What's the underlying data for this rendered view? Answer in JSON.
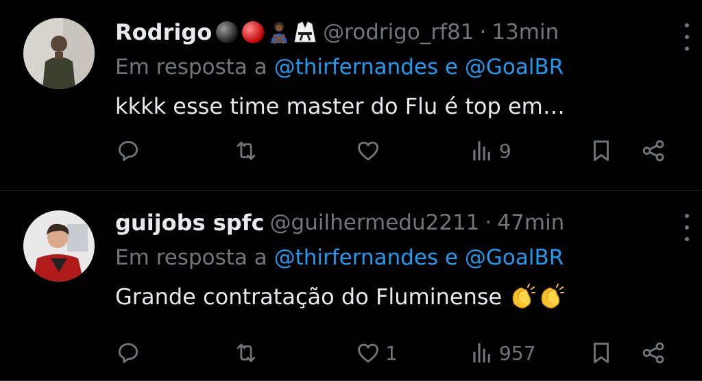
{
  "colors": {
    "background": "#000000",
    "text": "#e7e9ea",
    "muted": "#71767b",
    "link": "#1d9bf0",
    "divider": "#2f3336"
  },
  "tweets": [
    {
      "author": {
        "name": "Rodrigo",
        "handle": "@rodrigo_rf81",
        "badges": [
          "black-ball-emoji",
          "red-ball-emoji",
          "person-gesturing-no-emoji",
          "martial-arts-uniform-emoji"
        ]
      },
      "separator": "·",
      "time": "13min",
      "reply_prefix": "Em resposta a",
      "reply_mentions": "@thirfernandes e @GoalBR",
      "text": "kkkk esse time master do Flu é top em…",
      "text_emojis": [],
      "stats": {
        "replies": "",
        "reposts": "",
        "likes": "",
        "views": "9"
      }
    },
    {
      "author": {
        "name": "guijobs spfc",
        "handle": "@guilhermedu2211",
        "badges": []
      },
      "separator": "·",
      "time": "47min",
      "reply_prefix": "Em resposta a",
      "reply_mentions": "@thirfernandes e @GoalBR",
      "text": "Grande contratação do Fluminense",
      "text_emojis": [
        "clapping-hands-emoji",
        "clapping-hands-emoji"
      ],
      "stats": {
        "replies": "",
        "reposts": "",
        "likes": "1",
        "views": "957"
      }
    }
  ]
}
